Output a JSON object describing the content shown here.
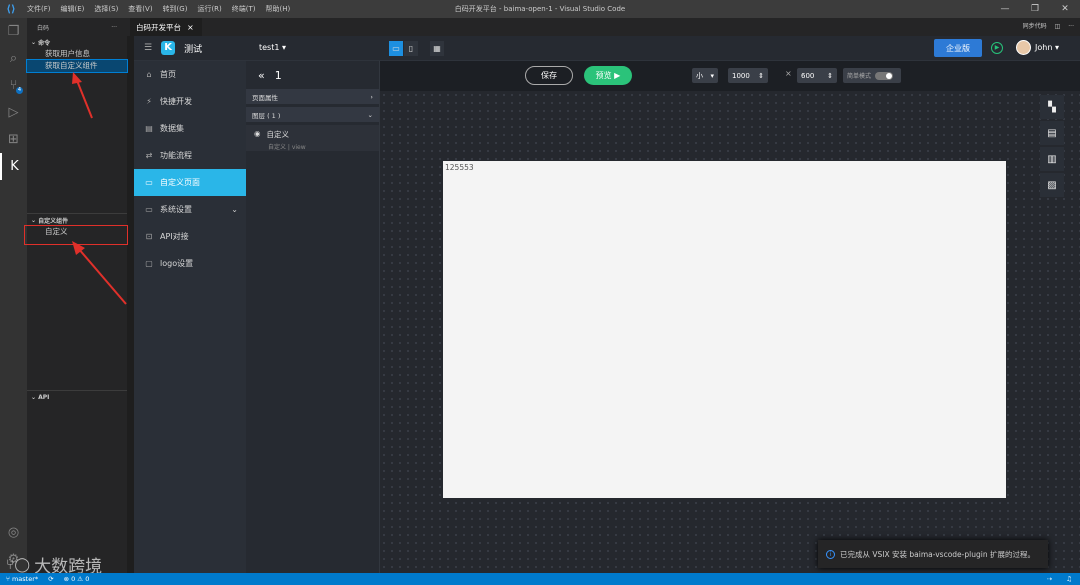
{
  "window": {
    "title": "白码开发平台 - baima-open-1 - Visual Studio Code",
    "menu": [
      "文件(F)",
      "编辑(E)",
      "选择(S)",
      "查看(V)",
      "转到(G)",
      "运行(R)",
      "终端(T)",
      "帮助(H)"
    ]
  },
  "sidebar": {
    "header": "白码",
    "more": "···",
    "section_commands": "命令",
    "commands": [
      "获取用户信息",
      "获取自定义组件"
    ],
    "section_components": "自定义组件",
    "components": [
      "自定义"
    ],
    "section_api": "API"
  },
  "editor_tab": {
    "label": "白码开发平台",
    "close": "×",
    "sync": "同步代码"
  },
  "app": {
    "logo_text": "测试",
    "project": "test1 ▾",
    "enterprise_label": "企业版",
    "user": "John ▾",
    "nav": [
      {
        "icon": "⌂",
        "label": "首页"
      },
      {
        "icon": "⚡",
        "label": "快捷开发"
      },
      {
        "icon": "▤",
        "label": "数据集"
      },
      {
        "icon": "⇄",
        "label": "功能流程"
      },
      {
        "icon": "▭",
        "label": "自定义页面"
      },
      {
        "icon": "▭",
        "label": "系统设置"
      },
      {
        "icon": "⊡",
        "label": "API对接"
      },
      {
        "icon": "▢",
        "label": "logo设置"
      }
    ],
    "page_number": "1",
    "panel_page_props": "页面属性",
    "panel_layers": "图层 ( 1 )",
    "layer_name": "自定义",
    "layer_sub": "自定义 | view",
    "save_label": "保存",
    "preview_label": "预览 ▶",
    "size_select": "小",
    "width_value": "1000",
    "height_value": "600",
    "times": "×",
    "simple_mode": "简单模式",
    "canvas_text": "125553"
  },
  "notification": "已完成从 VSIX 安装 baima-vscode-plugin 扩展的过程。",
  "status": {
    "branch": "master*",
    "problems": "⊗ 0 ⚠ 0"
  },
  "watermark": "大数跨境"
}
